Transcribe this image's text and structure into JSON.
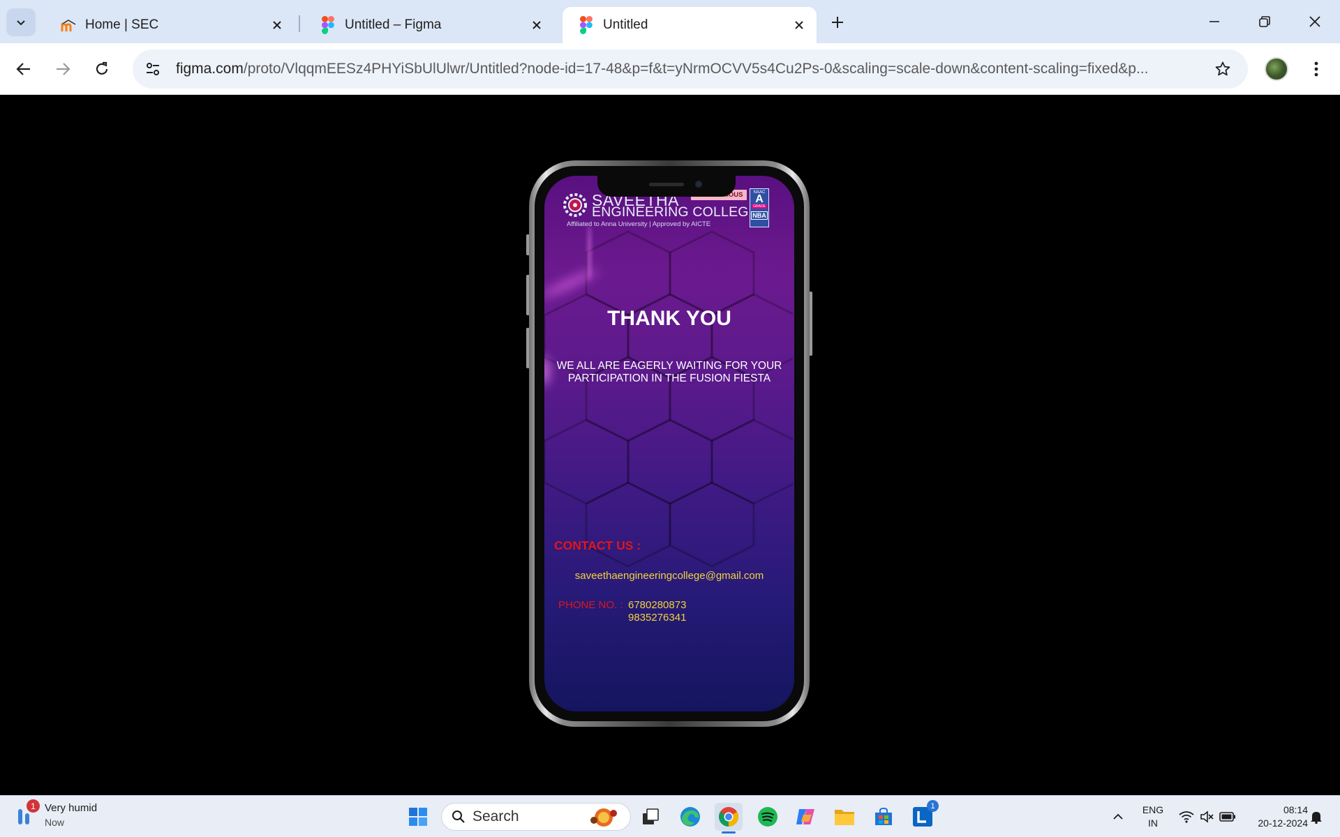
{
  "browser": {
    "tabs": [
      {
        "title": "Home | SEC",
        "favicon": "moodle-icon",
        "active": false
      },
      {
        "title": "Untitled – Figma",
        "favicon": "figma-icon",
        "active": false
      },
      {
        "title": "Untitled",
        "favicon": "figma-icon",
        "active": true
      }
    ],
    "url_host": "figma.com",
    "url_path": "/proto/VlqqmEESz4PHYiSbUlUlwr/Untitled?node-id=17-48&p=f&t=yNrmOCVV5s4Cu2Ps-0&scaling=scale-down&content-scaling=fixed&p..."
  },
  "prototype": {
    "logo": {
      "name_line1": "SAVEETHA",
      "name_line2": "ENGINEERING COLLEGE",
      "tagline": "Affiliated to Anna University | Approved by AICTE",
      "badge": "AUTONOMOUS",
      "naac_top": "NAAC",
      "naac_grade": "A",
      "naac_sub": "GRADE",
      "nba": "NBA"
    },
    "heading": "THANK YOU",
    "message_line1": "WE ALL ARE EAGERLY WAITING FOR YOUR",
    "message_line2": "PARTICIPATION IN THE FUSION FIESTA",
    "contact_title": "CONTACT US :",
    "email": "saveethaengineeringcollege@gmail.com",
    "phone_label": "PHONE NO. :",
    "phone_numbers": [
      "6780280873",
      "9835276341"
    ]
  },
  "taskbar": {
    "weather_title": "Very humid",
    "weather_sub": "Now",
    "weather_badge": "1",
    "search_label": "Search",
    "linkedin_badge": "1",
    "lang_top": "ENG",
    "lang_bottom": "IN",
    "time": "08:14",
    "date": "20-12-2024"
  },
  "colors": {
    "tabstrip": "#dbe6f6",
    "contact_red": "#e0161a",
    "contact_yellow": "#f2d33a"
  }
}
